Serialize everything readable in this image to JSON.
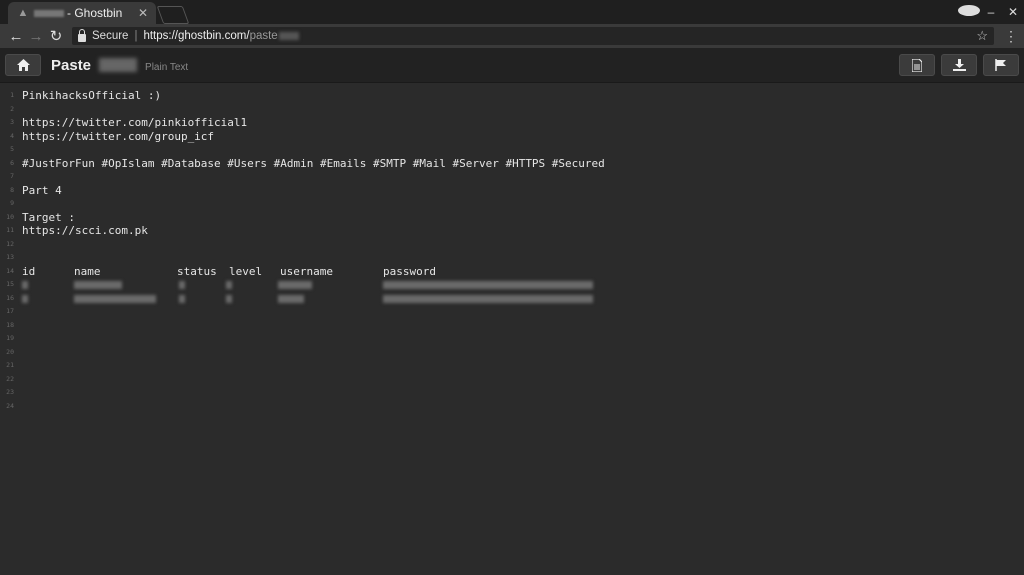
{
  "browser": {
    "tab_title": "- Ghostbin",
    "url_secure_label": "Secure",
    "url_main": "https://ghostbin.com/",
    "url_path": "paste"
  },
  "page": {
    "title": "Paste",
    "type_label": "Plain Text"
  },
  "code_lines": [
    "PinkihacksOfficial :)",
    "",
    "https://twitter.com/pinkiofficial1",
    "https://twitter.com/group_icf",
    "",
    "#JustForFun #OpIslam #Database #Users #Admin #Emails #SMTP #Mail #Server #HTTPS #Secured",
    "",
    "Part 4",
    "",
    "Target :",
    "https://scci.com.pk",
    "",
    "",
    "",
    "",
    "",
    "",
    "",
    "",
    "",
    "",
    "",
    "",
    ""
  ],
  "line_numbers": [
    "1",
    "2",
    "3",
    "4",
    "5",
    "6",
    "7",
    "8",
    "9",
    "10",
    "11",
    "12",
    "13",
    "14",
    "15",
    "16",
    "17",
    "18",
    "19",
    "20",
    "21",
    "22",
    "23",
    "24"
  ],
  "table_header": {
    "id": "id",
    "name": "name",
    "status": "status",
    "level": "level",
    "username": "username",
    "password": "password"
  },
  "icons": {
    "home": "home-icon",
    "raw": "document-icon",
    "download": "download-icon",
    "report": "flag-icon"
  }
}
